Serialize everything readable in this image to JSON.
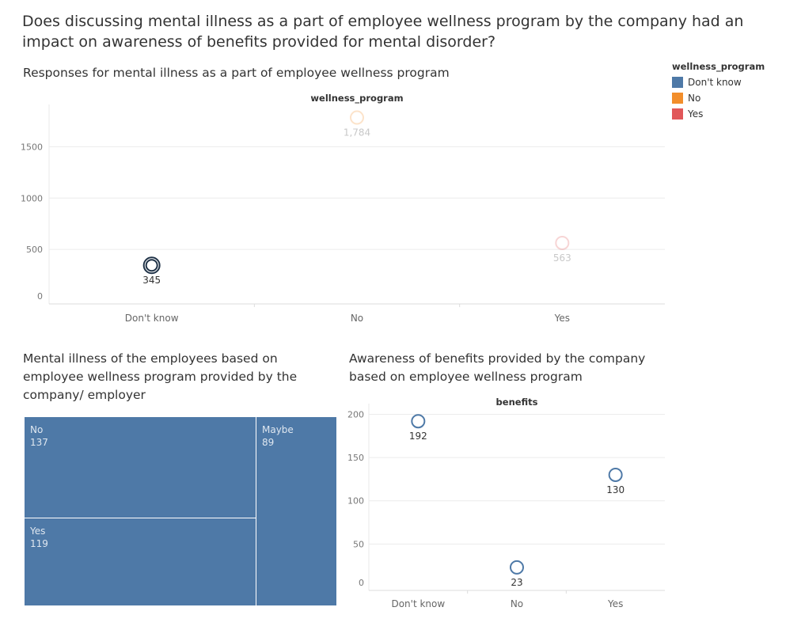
{
  "title": "Does discussing mental illness as a part of employee wellness program by the company had an impact on awareness of benefits provided for mental disorder?",
  "legend": {
    "title": "wellness_program",
    "items": [
      {
        "label": "Don't know",
        "color": "#4e79a7"
      },
      {
        "label": "No",
        "color": "#f28e2b"
      },
      {
        "label": "Yes",
        "color": "#e15759"
      }
    ]
  },
  "chart_data": [
    {
      "type": "scatter",
      "title": "Responses for mental illness as a part of employee wellness program",
      "xlabel": "wellness_program",
      "categories": [
        "Don't know",
        "No",
        "Yes"
      ],
      "values": [
        345,
        1784,
        563
      ],
      "value_labels": [
        "345",
        "1,784",
        "563"
      ],
      "highlighted": "Don't know",
      "ylim": [
        0,
        1850
      ],
      "yticks": [
        0,
        500,
        1000,
        1500
      ],
      "grid": true
    },
    {
      "type": "treemap",
      "title": "Mental illness of the employees based on employee wellness program provided by the company/ employer",
      "categories": [
        "No",
        "Maybe",
        "Yes"
      ],
      "values": [
        137,
        89,
        119
      ]
    },
    {
      "type": "scatter",
      "title": "Awareness of benefits provided by the company based on employee wellness program",
      "xlabel": "benefits",
      "categories": [
        "Don't know",
        "No",
        "Yes"
      ],
      "values": [
        192,
        23,
        130
      ],
      "value_labels": [
        "192",
        "23",
        "130"
      ],
      "ylim": [
        0,
        205
      ],
      "yticks": [
        0,
        50,
        100,
        150,
        200
      ],
      "grid": true
    }
  ]
}
